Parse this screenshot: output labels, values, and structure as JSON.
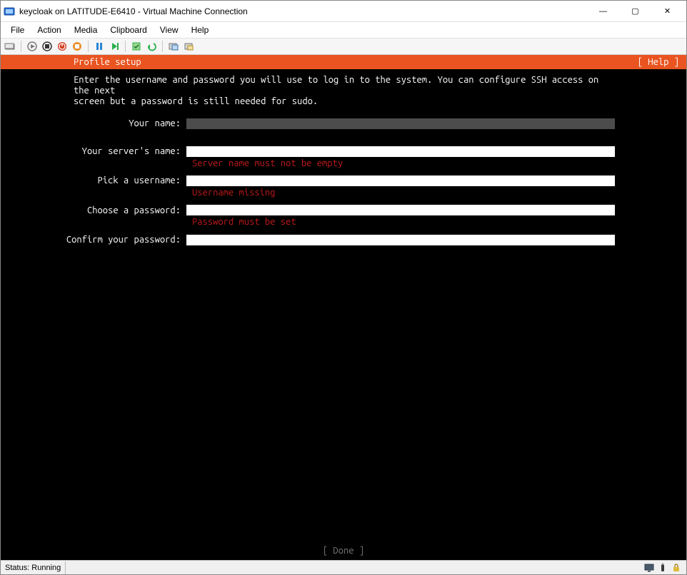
{
  "window": {
    "title": "keycloak on LATITUDE-E6410 - Virtual Machine Connection",
    "controls": {
      "min": "—",
      "max": "▢",
      "close": "✕"
    }
  },
  "menubar": [
    "File",
    "Action",
    "Media",
    "Clipboard",
    "View",
    "Help"
  ],
  "toolbar_icons": [
    "ctrl-alt-del-icon",
    "sep",
    "start-icon",
    "turnoff-icon",
    "shutdown-icon",
    "save-icon",
    "sep",
    "pause-icon",
    "reset-icon",
    "sep",
    "checkpoint-icon",
    "revert-icon",
    "sep",
    "enhanced-icon",
    "share-icon"
  ],
  "console": {
    "header_title": "Profile setup",
    "header_help": "[ Help ]",
    "instructions": "Enter the username and password you will use to log in to the system. You can configure SSH access on the next\nscreen but a password is still needed for sudo.",
    "fields": [
      {
        "label": "Your name:",
        "value": "",
        "error": "",
        "focused": true
      },
      {
        "label": "Your server's name:",
        "value": "",
        "error": "Server name must not be empty",
        "focused": false
      },
      {
        "label": "Pick a username:",
        "value": "",
        "error": "Username missing",
        "focused": false
      },
      {
        "label": "Choose a password:",
        "value": "",
        "error": "Password must be set",
        "focused": false
      },
      {
        "label": "Confirm your password:",
        "value": "",
        "error": "",
        "focused": false
      }
    ],
    "done_button": "[ Done       ]"
  },
  "statusbar": {
    "text": "Status: Running",
    "icons": [
      "display-icon",
      "usb-icon",
      "lock-icon"
    ]
  },
  "colors": {
    "ubuntu_orange": "#e95420",
    "error_red": "#c21a1a"
  }
}
